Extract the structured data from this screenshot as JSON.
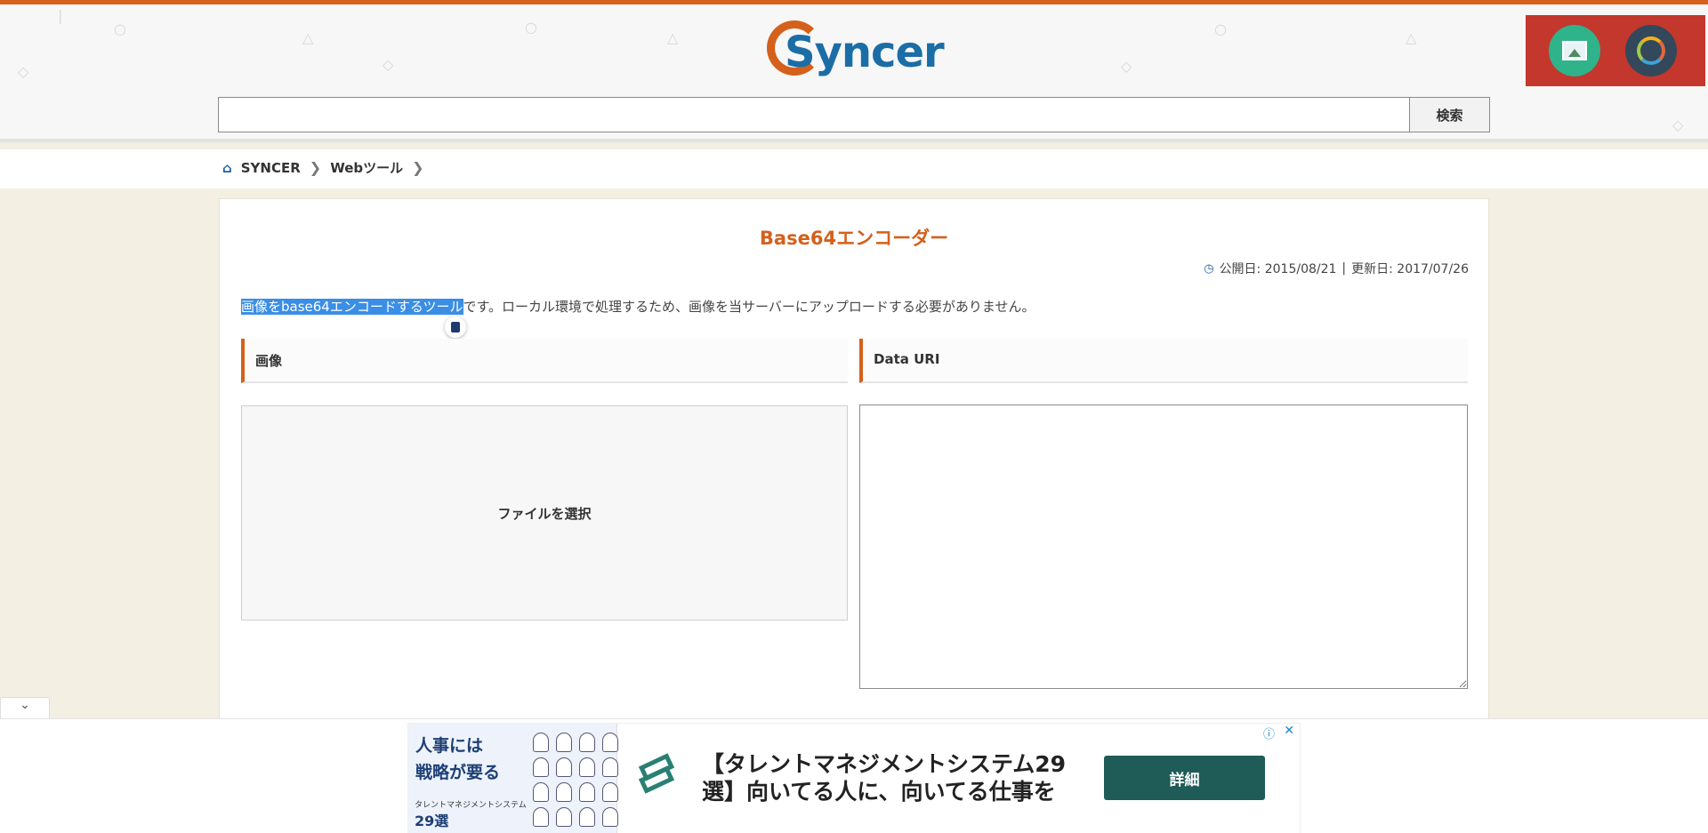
{
  "logo": {
    "text": "Syncer"
  },
  "search": {
    "placeholder": "",
    "button_label": "検索"
  },
  "extensions": {
    "items": [
      "image-viewer-extension",
      "sync-extension"
    ]
  },
  "breadcrumb": {
    "home": "SYNCER",
    "items": [
      "Webツール"
    ],
    "separator": "❯"
  },
  "article": {
    "title": "Base64エンコーダー",
    "published_label": "公開日: 2015/08/21",
    "updated_label": "更新日: 2017/07/26",
    "separator": "|",
    "desc_selected": "画像をbase64エンコードするツール",
    "desc_rest": "です。ローカル環境で処理するため、画像を当サーバーにアップロードする必要がありません。"
  },
  "sections": {
    "image_label": "画像",
    "datauri_label": "Data URI"
  },
  "file_input": {
    "label": "ファイルを選択"
  },
  "textarea": {
    "value": ""
  },
  "ad": {
    "left_headline_1": "人事には",
    "left_headline_2": "戦略が要る",
    "left_sub": "タレントマネジメントシステム",
    "left_num": "29選",
    "text": "【タレントマネジメントシステム29選】向いてる人に、向いてる仕事を",
    "button_label": "詳細",
    "info_icon": "ⓘ",
    "close_icon": "✕"
  },
  "colors": {
    "accent": "#d4601b",
    "brand_blue": "#1b6da6",
    "ad_button": "#1f5b57",
    "selection": "#3a8ee6"
  }
}
